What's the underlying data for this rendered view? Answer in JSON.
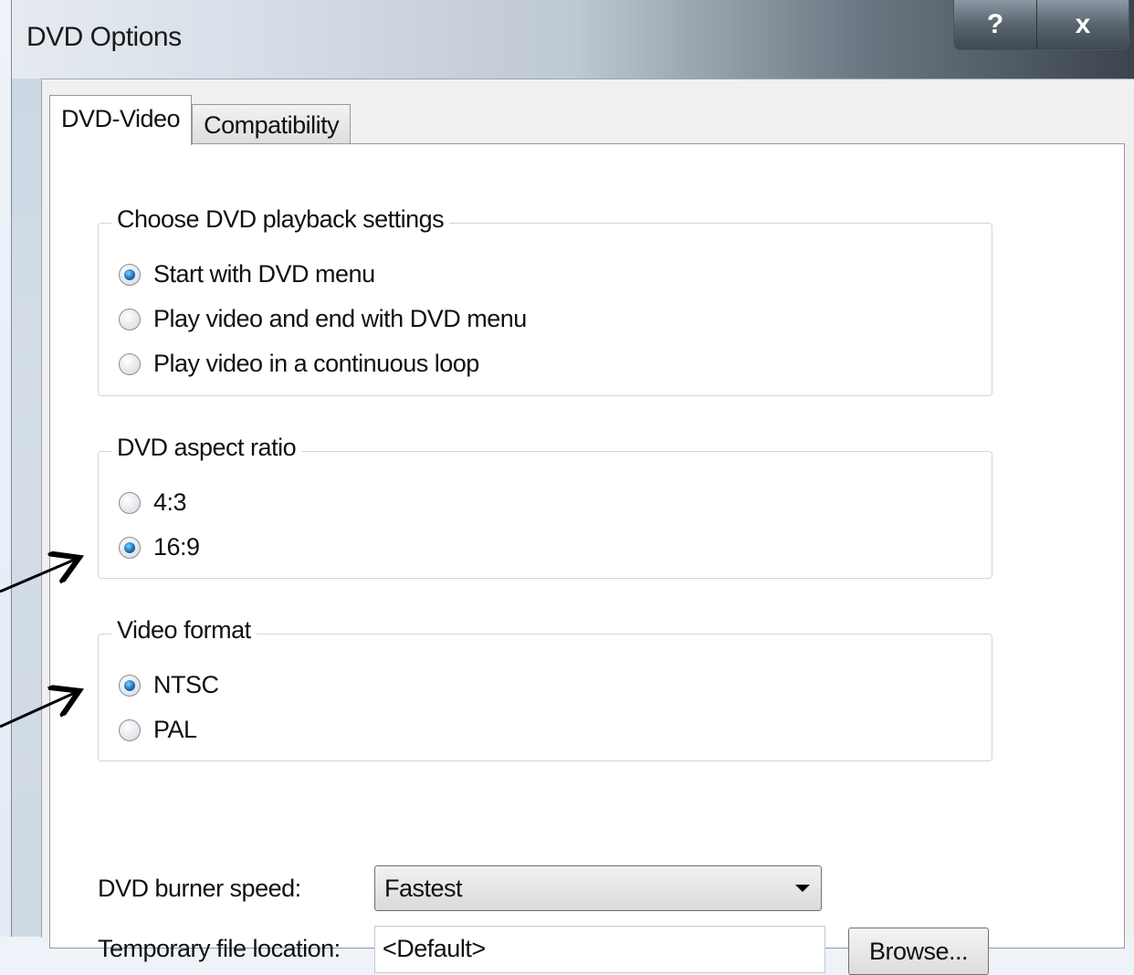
{
  "window": {
    "title": "DVD Options",
    "help_button": "?",
    "close_button": "x"
  },
  "tabs": [
    {
      "label": "DVD-Video",
      "active": true
    },
    {
      "label": "Compatibility",
      "active": false
    }
  ],
  "playback_group": {
    "legend": "Choose DVD playback settings",
    "options": [
      {
        "label": "Start with DVD menu",
        "checked": true
      },
      {
        "label": "Play video and end with DVD menu",
        "checked": false
      },
      {
        "label": "Play video in a continuous loop",
        "checked": false
      }
    ]
  },
  "aspect_group": {
    "legend": "DVD aspect ratio",
    "options": [
      {
        "label": "4:3",
        "checked": false
      },
      {
        "label": "16:9",
        "checked": true
      }
    ]
  },
  "format_group": {
    "legend": "Video format",
    "options": [
      {
        "label": "NTSC",
        "checked": true
      },
      {
        "label": "PAL",
        "checked": false
      }
    ]
  },
  "burner_speed": {
    "label": "DVD burner speed:",
    "selected": "Fastest"
  },
  "temp_location": {
    "label": "Temporary file location:",
    "value": "<Default>",
    "browse_label": "Browse..."
  },
  "colors": {
    "radio_selected": "#1b6fb7",
    "annotation_arrow": "#000000"
  }
}
